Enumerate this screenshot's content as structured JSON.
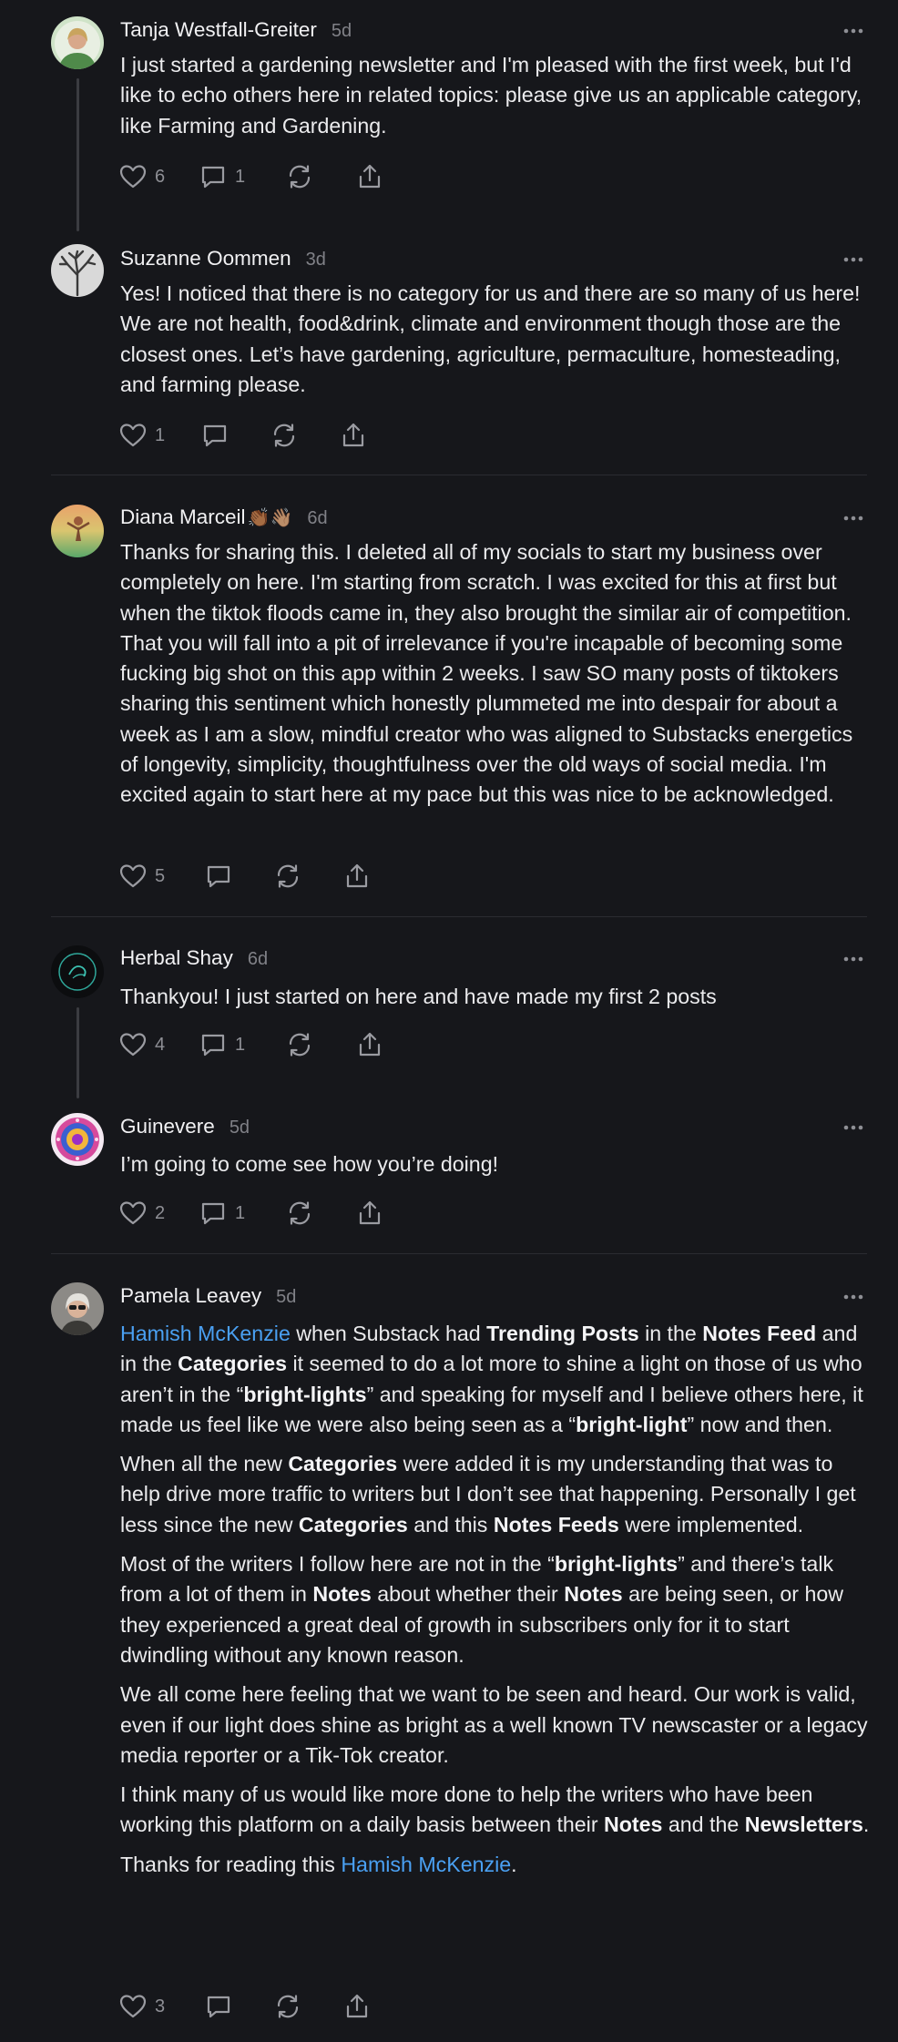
{
  "notes": [
    {
      "author": "Tanja Westfall-Greiter",
      "time": "5d",
      "paragraphs": [
        "I just started a gardening newsletter and I'm pleased with the first week, but I'd like to echo others here in related topics: please give us an applicable category, like Farming and Gardening."
      ],
      "likes": "6",
      "comments": "1",
      "avatar_icon": "profile-photo-woman-green"
    },
    {
      "author": "Suzanne Oommen",
      "time": "3d",
      "paragraphs": [
        "Yes! I noticed that there is no category for us and there are so many of us here! We are not health, food&drink, climate and environment though those are the closest ones. Let’s have gardening, agriculture, permaculture, homesteading, and farming please."
      ],
      "likes": "1",
      "comments": "",
      "avatar_icon": "profile-photo-bare-tree"
    },
    {
      "author": "Diana Marceil",
      "author_emoji": "👏🏾👋🏽",
      "time": "6d",
      "paragraphs": [
        "Thanks for sharing this. I deleted all of my socials to start my business over completely on here. I'm starting from scratch. I was excited for this at first but when the tiktok floods came in, they also brought the similar air of competition. That you will fall into a pit of irrelevance if you're incapable of becoming some fucking big shot on this app within 2 weeks. I saw SO many posts of tiktokers sharing this sentiment which honestly plummeted me into despair for about a week as I am a slow, mindful creator who was aligned to Substacks energetics of longevity, simplicity, thoughtfulness over the old ways of social media. I'm excited again to start here at my pace but this was nice to be acknowledged."
      ],
      "likes": "5",
      "comments": "",
      "avatar_icon": "profile-photo-sunset-figure"
    },
    {
      "author": "Herbal Shay",
      "time": "6d",
      "paragraphs": [
        "Thankyou! I just started on here and have made my first 2 posts"
      ],
      "likes": "4",
      "comments": "1",
      "avatar_icon": "profile-photo-dark-logo"
    },
    {
      "author": "Guinevere",
      "time": "5d",
      "paragraphs": [
        "I’m going to come see how you’re doing!"
      ],
      "likes": "2",
      "comments": "1",
      "avatar_icon": "profile-photo-mandala"
    },
    {
      "author": "Pamela Leavey",
      "time": "5d",
      "p1": {
        "mention": "Hamish McKenzie",
        "t1": " when Substack had ",
        "b1": "Trending Posts",
        "t2": " in the ",
        "b2": "Notes Feed",
        "t3": " and in the ",
        "b3": "Categories",
        "t4": " it seemed to do a lot more to shine a light on those of us who aren’t in the “",
        "b4": "bright-lights",
        "t5": "” and speaking for myself and I believe others here, it made us feel like we were also being seen as a “",
        "b5": "bright-light",
        "t6": "” now and then."
      },
      "p2": {
        "t1": "When all the new ",
        "b1": "Categories",
        "t2": " were added it is my understanding that was to help drive more traffic to writers but I don’t see that happening. Personally I get less since the new ",
        "b2": "Categories",
        "t3": " and this ",
        "b3": "Notes Feeds",
        "t4": " were implemented."
      },
      "p3": {
        "t1": "Most of the writers I follow here are not in the “",
        "b1": "bright-lights",
        "t2": "” and there’s talk from a lot of them in ",
        "b2": "Notes",
        "t3": " about whether their ",
        "b3": "Notes",
        "t4": " are being seen, or how they experienced a great deal of growth in subscribers only for it to start dwindling without any known reason."
      },
      "p4": "We all come here feeling that we want to be seen and heard. Our work is valid, even if our light does shine as bright as a well known TV newscaster or a legacy media reporter or a Tik-Tok creator.",
      "p5": {
        "t1": "I think many of us would like more done to help the writers who have been working this platform on a daily basis between their ",
        "b1": "Notes",
        "t2": " and the ",
        "b2": "Newsletters",
        "t3": "."
      },
      "p6": {
        "t1": "Thanks for reading this ",
        "mention": "Hamish McKenzie",
        "t2": "."
      },
      "likes": "3",
      "comments": "",
      "avatar_icon": "profile-photo-woman-sunglasses"
    }
  ],
  "icons": {
    "like": "heart-icon",
    "comment": "comment-bubble-icon",
    "restack": "restack-icon",
    "share": "share-icon",
    "more": "more-dots-icon"
  },
  "colors": {
    "background": "#16171b",
    "text": "#ebebed",
    "muted": "#808187",
    "mention": "#4aa0f2",
    "divider": "#2b2c31"
  }
}
